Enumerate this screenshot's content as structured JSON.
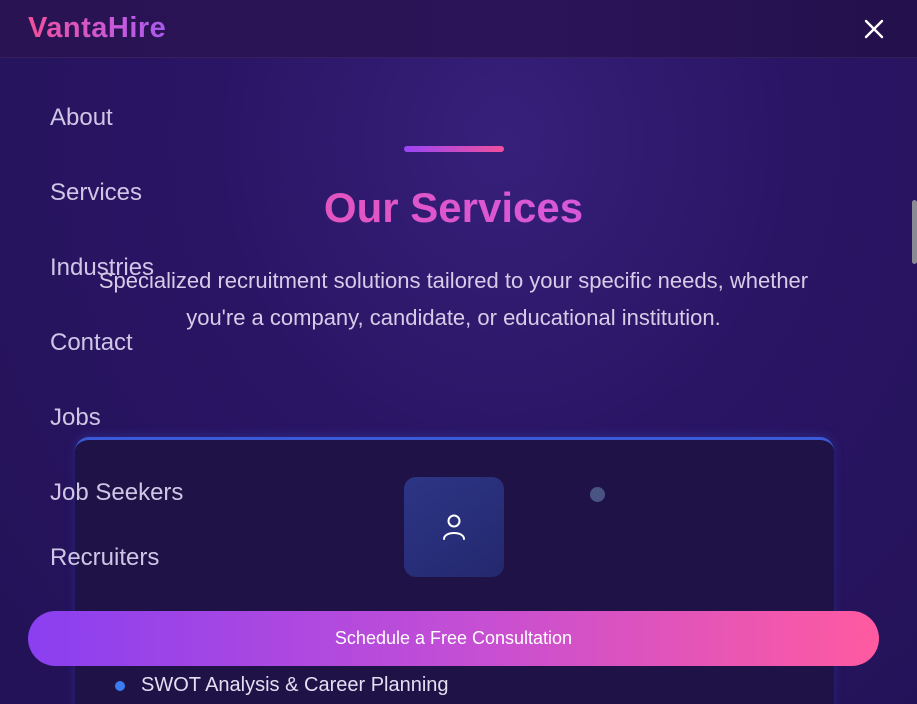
{
  "header": {
    "brand": "VantaHire",
    "close_icon": "close-icon"
  },
  "nav": {
    "items": [
      {
        "label": "About"
      },
      {
        "label": "Services"
      },
      {
        "label": "Industries"
      },
      {
        "label": "Contact"
      },
      {
        "label": "Jobs"
      },
      {
        "label": "Job Seekers"
      },
      {
        "label": "Recruiters"
      }
    ],
    "cta_label": "Schedule a Free Consultation"
  },
  "services": {
    "title": "Our Services",
    "subtitle": "Specialized recruitment solutions tailored to your specific needs, whether you're a company, candidate, or educational institution.",
    "card": {
      "icon": "user-icon",
      "features": [
        {
          "label": "SWOT Analysis & Career Planning"
        }
      ]
    }
  },
  "colors": {
    "background": "#2a1565",
    "brand_pink": "#f0509c",
    "brand_purple": "#9b45f5",
    "card_accent": "#3a5ad8",
    "bullet_blue": "#3b7cf2"
  }
}
